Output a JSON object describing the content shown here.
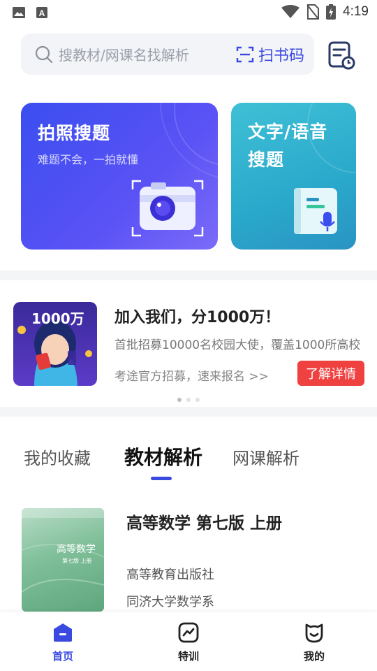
{
  "status_bar": {
    "time": "4:19"
  },
  "search": {
    "placeholder": "搜教材/网课名找解析",
    "scan_label": "扫书码"
  },
  "feature_cards": [
    {
      "title": "拍照搜题",
      "subtitle": "难题不会，一拍就懂"
    },
    {
      "title_line1": "文字/语音",
      "title_line2": "搜题"
    }
  ],
  "banner": {
    "image_text": "1000万",
    "title": "加入我们，分1000万！",
    "description": "首批招募10000名校园大使，覆盖1000所高校",
    "link_text": "考途官方招募，速来报名 >>",
    "button_label": "了解详情"
  },
  "tabs": [
    {
      "label": "我的收藏",
      "active": false
    },
    {
      "label": "教材解析",
      "active": true
    },
    {
      "label": "网课解析",
      "active": false
    }
  ],
  "book": {
    "cover_title": "高等数学",
    "cover_subtitle": "第七版 上册",
    "title": "高等数学 第七版 上册",
    "publisher": "高等教育出版社",
    "author": "同济大学数学系"
  },
  "bottom_nav": [
    {
      "label": "首页",
      "icon": "home-icon",
      "active": true
    },
    {
      "label": "特训",
      "icon": "training-icon",
      "active": false
    },
    {
      "label": "我的",
      "icon": "profile-icon",
      "active": false
    }
  ],
  "colors": {
    "accent": "#3a49e0",
    "cta_red": "#ef4140"
  }
}
